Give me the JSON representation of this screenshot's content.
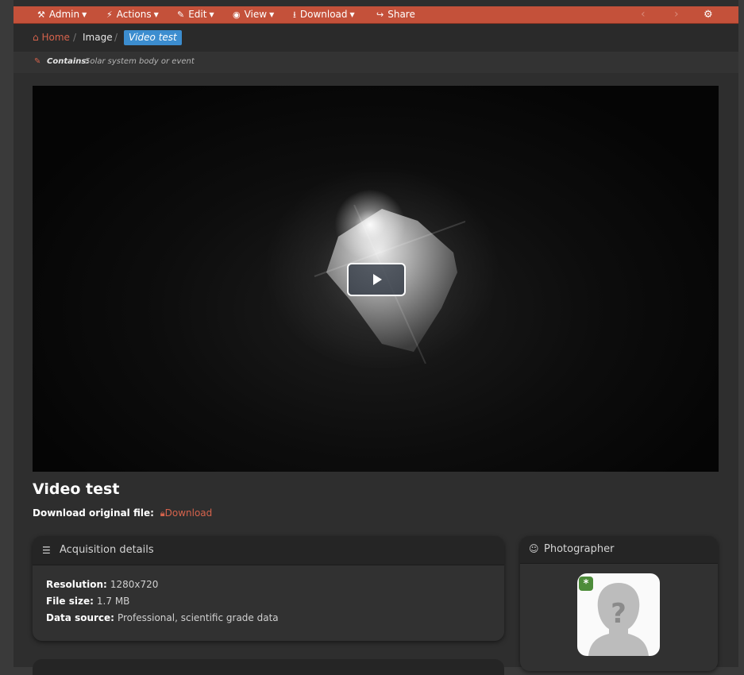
{
  "toolbar": {
    "items": [
      {
        "label": "Admin",
        "icon": "gavel-icon"
      },
      {
        "label": "Actions",
        "icon": "bolt-icon"
      },
      {
        "label": "Edit",
        "icon": "pencil-icon"
      },
      {
        "label": "View",
        "icon": "eye-icon"
      },
      {
        "label": "Download",
        "icon": "download-icon"
      },
      {
        "label": "Share",
        "icon": "share-icon"
      }
    ]
  },
  "breadcrumb": {
    "home": "Home",
    "image": "Image",
    "current": "Video test"
  },
  "contains": {
    "label": "Contains:",
    "value": "Solar system body or event"
  },
  "image": {
    "title": "Video test",
    "download_label": "Download original file",
    "download_link": "Download"
  },
  "acquisition": {
    "heading": "Acquisition details",
    "rows": [
      {
        "key": "Resolution:",
        "value": "1280x720"
      },
      {
        "key": "File size:",
        "value": "1.7 MB"
      },
      {
        "key": "Data source:",
        "value": "Professional, scientific grade data"
      }
    ]
  },
  "photographer": {
    "heading": "Photographer"
  },
  "colors": {
    "accent": "#c4513a",
    "link": "#d6634c",
    "active_crumb": "#3c8dcf"
  }
}
